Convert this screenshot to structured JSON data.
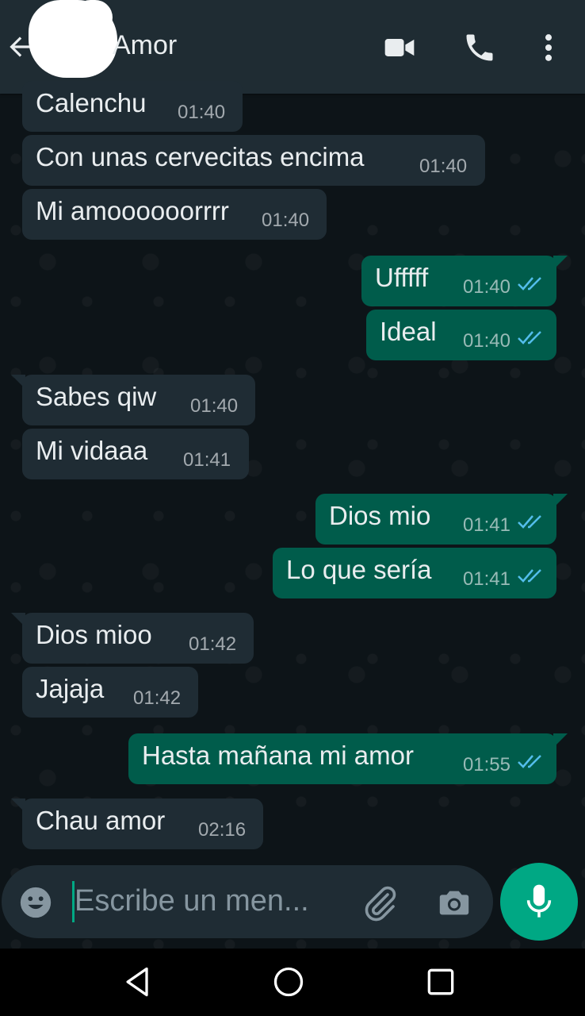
{
  "header": {
    "title": "Amor",
    "icons": [
      "back-arrow-icon",
      "video-call-icon",
      "phone-call-icon",
      "more-options-icon"
    ]
  },
  "messages": [
    {
      "direction": "in",
      "text": "Calenchu",
      "time": "01:40"
    },
    {
      "direction": "in",
      "text": "Con unas cervecitas encima",
      "time": "01:40"
    },
    {
      "direction": "in",
      "text": "Mi amoooooorrrr",
      "time": "01:40"
    },
    {
      "direction": "out",
      "text": "Ufffff",
      "time": "01:40",
      "status": "read"
    },
    {
      "direction": "out",
      "text": "Ideal",
      "time": "01:40",
      "status": "read"
    },
    {
      "direction": "in",
      "text": "Sabes qiw",
      "time": "01:40"
    },
    {
      "direction": "in",
      "text": "Mi vidaaa",
      "time": "01:41"
    },
    {
      "direction": "out",
      "text": "Dios mio",
      "time": "01:41",
      "status": "read"
    },
    {
      "direction": "out",
      "text": "Lo que sería",
      "time": "01:41",
      "status": "read"
    },
    {
      "direction": "in",
      "text": "Dios mioo",
      "time": "01:42"
    },
    {
      "direction": "in",
      "text": "Jajaja",
      "time": "01:42"
    },
    {
      "direction": "out",
      "text": "Hasta mañana mi amor",
      "time": "01:55",
      "status": "read"
    },
    {
      "direction": "in",
      "text": "Chau amor",
      "time": "02:16"
    }
  ],
  "composer": {
    "placeholder": "Escribe un men...",
    "icons": [
      "emoji-icon",
      "attach-icon",
      "camera-icon",
      "microphone-icon"
    ]
  },
  "navbar": {
    "icons": [
      "nav-back-icon",
      "nav-home-icon",
      "nav-recent-apps-icon"
    ]
  },
  "colors": {
    "header_bg": "#1f2c33",
    "incoming_bubble": "#1f2c34",
    "outgoing_bubble": "#005c4b",
    "accent": "#00a884",
    "read_ticks": "#53bdeb"
  }
}
